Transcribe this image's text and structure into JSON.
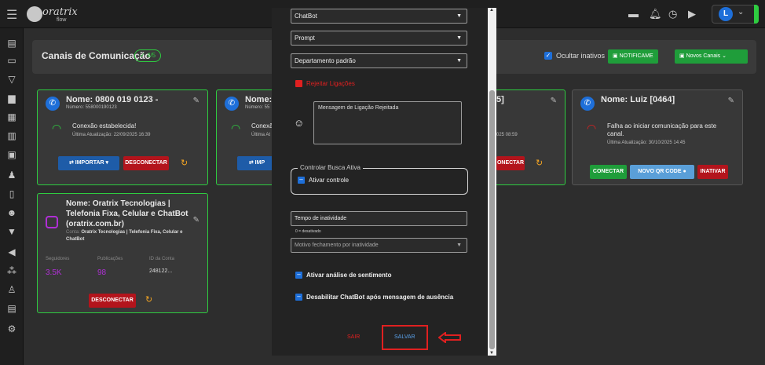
{
  "brand": {
    "name": "oratrix",
    "sub": "flow"
  },
  "user": {
    "initial": "L"
  },
  "page": {
    "title": "Canais de Comunicação",
    "badge": "4/5",
    "checkbox_label": "Ocultar inativos",
    "btn_notify": "NOTIFICAME",
    "btn_new": "Novos Canais"
  },
  "cards": [
    {
      "name": "Nome: 0800 019 0123 -",
      "number": "Número: 558000190123",
      "status": "Conexão estabelecida!",
      "updated": "Última Atualização: 22/09/2025 16:39",
      "btn1": "IMPORTAR",
      "btn2": "DESCONECTAR"
    },
    {
      "name": "Nome:",
      "number": "Número: 55",
      "status": "Conexã",
      "updated": "Última At",
      "btn1": "IMP"
    },
    {
      "name": "5]",
      "updated": "025 08:59",
      "btn2": "ONECTAR"
    },
    {
      "name": "Nome: Luiz [0464]",
      "status": "Falha ao iniciar comunicação para este canal.",
      "updated": "Última Atualização: 30/10/2025 14:45",
      "btn1": "CONECTAR",
      "btn2": "NOVO QR CODE",
      "btn3": "INATIVAR"
    }
  ],
  "insta_card": {
    "name": "Nome: Oratrix Tecnologias | Telefonia Fixa, Celular e ChatBot (oratrix.com.br)",
    "account_label": "Conta:",
    "account_value": "Oratrix Tecnologias | Telefonia Fixa, Celular e ChatBot",
    "stats": [
      {
        "label": "Seguidores",
        "value": "3.5K"
      },
      {
        "label": "Publicações",
        "value": "98"
      },
      {
        "label": "ID da Conta",
        "value": "248122..."
      }
    ],
    "btn": "DESCONECTAR"
  },
  "modal": {
    "select_chatbot": "ChatBot",
    "select_prompt": "Prompt",
    "select_dept": "Departamento padrão",
    "reject_calls": "Rejeitar Ligações",
    "reject_msg_placeholder": "Mensagem de Ligação Rejeitada",
    "fieldset_legend": "Controlar Busca Ativa",
    "activate_control": "Ativar controle",
    "inactivity_placeholder": "Tempo de inatividade",
    "inactivity_hint": "0 = desativado",
    "close_reason": "Motivo fechamento por inatividade",
    "sentiment": "Ativar análise de sentimento",
    "disable_chatbot": "Desabilitar ChatBot após mensagem de ausência",
    "btn_exit": "SAIR",
    "btn_save": "SALVAR"
  }
}
